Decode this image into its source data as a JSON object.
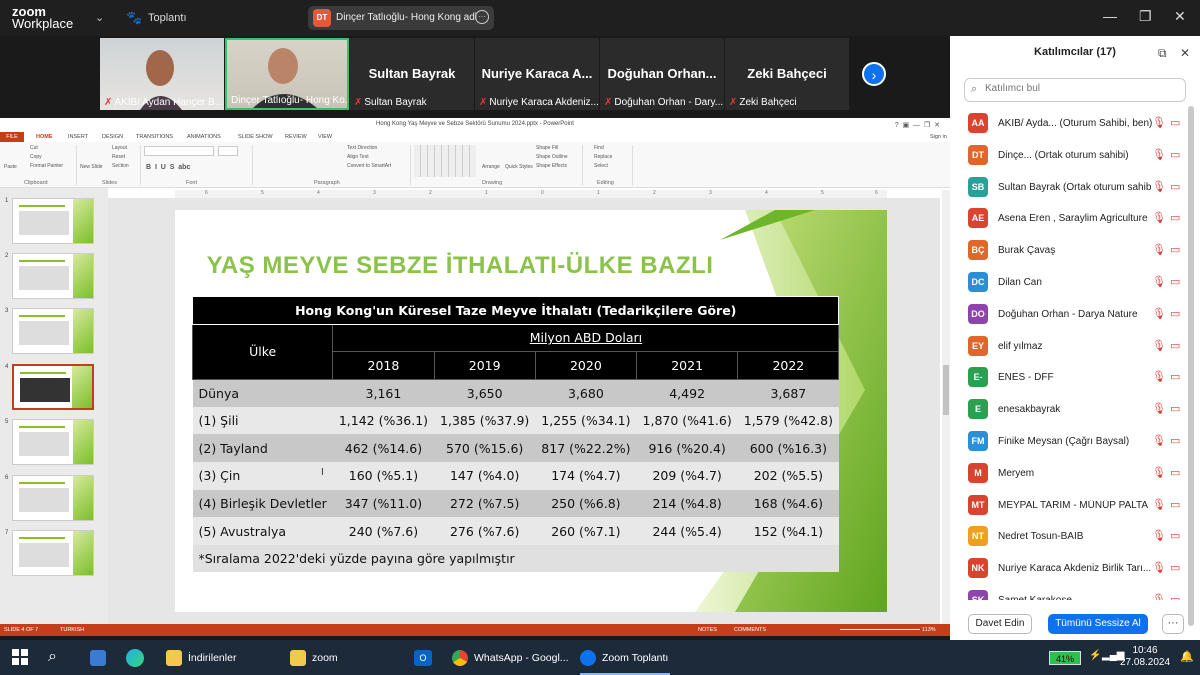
{
  "zoom": {
    "logo_line1": "zoom",
    "logo_line2": "Workplace",
    "meeting_label": "Toplantı",
    "share_initials": "DT",
    "share_title": "Dinçer Tatlıoğlu- Hong Kong adl",
    "share_more": "···"
  },
  "video_strip": {
    "tiles": [
      {
        "name": "AKİB/ Aydan Hançer B...",
        "big": ""
      },
      {
        "name": "Dinçer Tatlıoğlu- Hong Ko...",
        "big": ""
      },
      {
        "name": "Sultan Bayrak",
        "big": "Sultan Bayrak"
      },
      {
        "name": "Nuriye Karaca Akdeniz...",
        "big": "Nuriye Karaca A..."
      },
      {
        "name": "Doğuhan Orhan - Dary...",
        "big": "Doğuhan Orhan..."
      },
      {
        "name": "Zeki Bahçeci",
        "big": "Zeki Bahçeci"
      }
    ]
  },
  "participants": {
    "title": "Katılımcılar (17)",
    "search_placeholder": "Katılımcı bul",
    "list": [
      {
        "initials": "AA",
        "color": "#d9432f",
        "name": "AKİB/ Ayda... (Oturum Sahibi, ben)"
      },
      {
        "initials": "DT",
        "color": "#e0662c",
        "name": "Dinçe...  (Ortak oturum sahibi)"
      },
      {
        "initials": "SB",
        "color": "#2aa198",
        "name": "Sultan Bayrak (Ortak oturum sahibi)"
      },
      {
        "initials": "AE",
        "color": "#d9432f",
        "name": "Asena Eren , Saraylim Agriculture"
      },
      {
        "initials": "BÇ",
        "color": "#e0662c",
        "name": "Burak Çavaş"
      },
      {
        "initials": "DC",
        "color": "#2a8fd4",
        "name": "Dilan Can"
      },
      {
        "initials": "DO",
        "color": "#8e44ad",
        "name": "Doğuhan Orhan - Darya Nature"
      },
      {
        "initials": "EY",
        "color": "#e0662c",
        "name": "elif yılmaz"
      },
      {
        "initials": "E-",
        "color": "#2aa150",
        "name": "ENES - DFF"
      },
      {
        "initials": "E",
        "color": "#2aa150",
        "name": "enesakbayrak"
      },
      {
        "initials": "FM",
        "color": "#2a8fd4",
        "name": "Finike Meysan (Çağrı Baysal)"
      },
      {
        "initials": "M",
        "color": "#d9432f",
        "name": "Meryem"
      },
      {
        "initials": "MT",
        "color": "#d9432f",
        "name": "MEYPAL TARIM - MÜNÜP PALTA"
      },
      {
        "initials": "NT",
        "color": "#f0a020",
        "name": "Nedret Tosun-BAİB"
      },
      {
        "initials": "NK",
        "color": "#d9432f",
        "name": "Nuriye Karaca Akdeniz Birlik Tarı..."
      },
      {
        "initials": "SK",
        "color": "#8e44ad",
        "name": "Samet Karakose"
      }
    ],
    "invite_label": "Davet Edin",
    "mute_all_label": "Tümünü Sessize Al",
    "more_label": "···"
  },
  "ppt": {
    "window_title": "Hong Kong Yaş Meyve ve Sebze Sektörü Sunumu 2024.pptx - PowerPoint",
    "signin": "Sign in",
    "tabs": [
      "FILE",
      "HOME",
      "INSERT",
      "DESIGN",
      "TRANSITIONS",
      "ANIMATIONS",
      "SLIDE SHOW",
      "REVIEW",
      "VIEW"
    ],
    "groups": [
      "Clipboard",
      "Slides",
      "Font",
      "Paragraph",
      "Drawing",
      "Editing"
    ],
    "clipboard_items": [
      "Cut",
      "Copy",
      "Format Painter",
      "Paste"
    ],
    "slides_items": [
      "New Slide",
      "Layout",
      "Reset",
      "Section"
    ],
    "paragraph_items": [
      "Text Direction",
      "Align Text",
      "Convert to SmartArt"
    ],
    "drawing_items": [
      "Arrange",
      "Quick Styles",
      "Shape Fill",
      "Shape Outline",
      "Shape Effects"
    ],
    "editing_items": [
      "Find",
      "Replace",
      "Select"
    ],
    "ruler_ticks": [
      "6",
      "5",
      "4",
      "3",
      "2",
      "1",
      "0",
      "1",
      "2",
      "3",
      "4",
      "5",
      "6"
    ],
    "thumb_numbers": [
      "1",
      "2",
      "3",
      "4",
      "5",
      "6",
      "7"
    ],
    "status": {
      "slide": "SLIDE 4 OF 7",
      "lang": "TURKISH",
      "notes": "NOTES",
      "comments": "COMMENTS",
      "zoom": "113%"
    }
  },
  "slide": {
    "title": "YAŞ MEYVE SEBZE İTHALATI-ÜLKE BAZLI",
    "table_title": "Hong Kong'un Küresel Taze Meyve İthalatı (Tedarikçilere Göre)",
    "col_country": "Ülke",
    "unit": "Milyon ABD Doları",
    "years": [
      "2018",
      "2019",
      "2020",
      "2021",
      "2022"
    ],
    "rows": [
      {
        "country": "Dünya",
        "values": [
          "3,161",
          "3,650",
          "3,680",
          "4,492",
          "3,687"
        ]
      },
      {
        "country": "(1) Şili",
        "values": [
          "1,142 (%36.1)",
          "1,385 (%37.9)",
          "1,255 (%34.1)",
          "1,870 (%41.6)",
          "1,579 (%42.8)"
        ]
      },
      {
        "country": "(2) Tayland",
        "values": [
          "462 (%14.6)",
          "570 (%15.6)",
          "817 (%22.2%)",
          "916 (%20.4)",
          "600 (%16.3)"
        ]
      },
      {
        "country": "(3) Çin",
        "values": [
          "160 (%5.1)",
          "147 (%4.0)",
          "174 (%4.7)",
          "209 (%4.7)",
          "202 (%5.5)"
        ]
      },
      {
        "country": "(4) Birleşik Devletler",
        "values": [
          "347 (%11.0)",
          "272 (%7.5)",
          "250 (%6.8)",
          "214 (%4.8)",
          "168 (%4.6)"
        ]
      },
      {
        "country": "(5) Avustralya",
        "values": [
          "240 (%7.6)",
          "276 (%7.6)",
          "260 (%7.1)",
          "244 (%5.4)",
          "152 (%4.1)"
        ]
      }
    ],
    "note": "*Sıralama 2022'deki yüzde payına göre yapılmıştır"
  },
  "taskbar": {
    "apps": [
      {
        "label": "İndirilenler",
        "color": "#f2c94c"
      },
      {
        "label": "zoom",
        "color": "#f2c94c"
      },
      {
        "label": "WhatsApp - Googl...",
        "color": "#4caf50"
      },
      {
        "label": "Zoom Toplantı",
        "color": "#0e72ed"
      }
    ],
    "battery": "41%",
    "time": "10:46",
    "date": "27.08.2024"
  }
}
